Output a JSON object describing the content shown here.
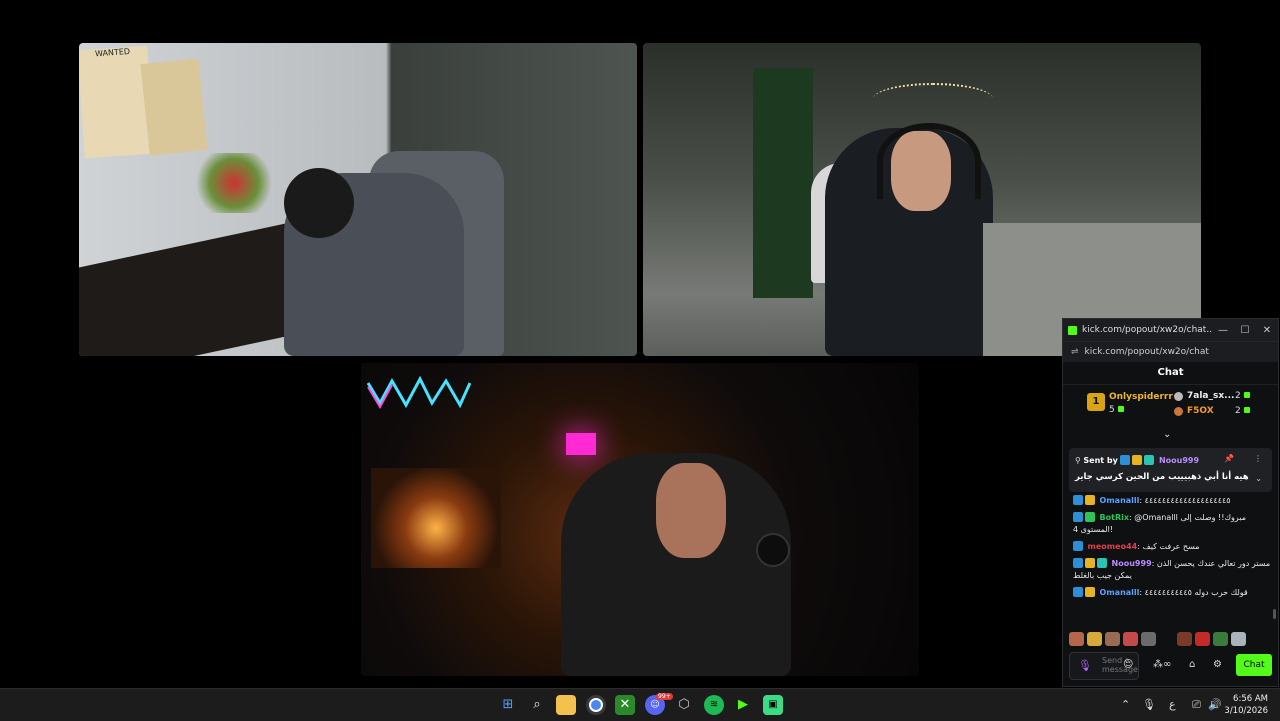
{
  "feeds": {
    "top_left": {
      "poster_text": "WANTED"
    },
    "top_right": {},
    "bottom": {}
  },
  "chat_window": {
    "title": "kick.com/popout/xw2o/chat...",
    "url": "kick.com/popout/xw2o/chat",
    "header": "Chat",
    "leaders": [
      {
        "rank": "1",
        "name": "Onlyspiderrr",
        "count": "5"
      },
      {
        "name": "7ala_sx...",
        "count": "2"
      },
      {
        "name": "F5OX",
        "count": "2"
      }
    ],
    "pinned": {
      "sent_by": "Sent by",
      "user": "Noou999",
      "text": "هيه أنا أبي ذهبيييب من الحين كرسي جاير"
    },
    "messages": [
      {
        "user": "Omanalll",
        "text": ": ٤٤٤٤٤٤٤٤٤٤٤٤٤٤٤٤٤٤٤٥",
        "user_color": "#5aa0ff"
      },
      {
        "user": "BotRix",
        "text": ": @Omanalll مبروك!! وصلت إلى المستوى 4!",
        "user_color": "#2ec45a"
      },
      {
        "user": "meomeo44",
        "text": ": مسح عرفت كيف",
        "user_color": "#e0404a"
      },
      {
        "user": "Noou999",
        "text": ": مستر دور تعالي عندك يحسن الذن يمكن جيب بالغلط",
        "user_color": "#b98cff"
      },
      {
        "user": "Omanalll",
        "text": ": قولك حرب دوله ٤٤٤٤٤٤٤٤٤٤٥",
        "user_color": "#5aa0ff"
      }
    ],
    "input_placeholder": "Send a message",
    "chat_button": "Chat"
  },
  "taskbar": {
    "time": "6:56 AM",
    "date": "3/10/2026",
    "lang": "ع",
    "badge": "99+"
  },
  "colors": {
    "kick_green": "#53fc18",
    "background": "#000000"
  }
}
